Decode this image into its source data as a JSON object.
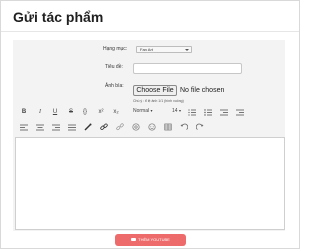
{
  "dialog": {
    "title": "Gửi tác phẩm"
  },
  "form": {
    "category": {
      "label": "Hạng mục:",
      "value": "Fan Art"
    },
    "title_field": {
      "label": "Tiêu đề:",
      "value": ""
    },
    "cover": {
      "label": "Ảnh bìa:",
      "button_label": "Choose File",
      "file_status": "No file chosen",
      "hint": "Chú ý : tỉ lệ ảnh 1/1 (hình vuông)"
    }
  },
  "toolbar": {
    "bold": "B",
    "italic": "I",
    "underline": "U",
    "strike": "S",
    "code": "{}",
    "superscript": "x²",
    "subscript": "x₂",
    "format": "Normal",
    "font_size": "14"
  },
  "editor": {
    "content": ""
  },
  "footer": {
    "youtube_button": "THÊM YOUTUBE"
  }
}
